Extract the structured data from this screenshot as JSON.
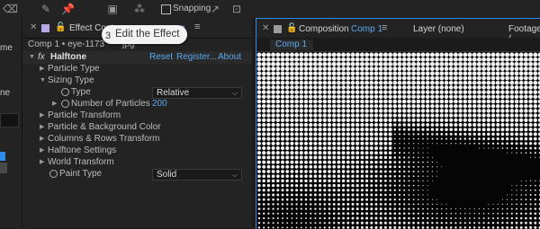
{
  "toolbar": {
    "icons": [
      "eraser-icon",
      "brush-icon",
      "pin-icon",
      "camera-icon",
      "scatter-icon",
      "snapping-icon"
    ],
    "snapping_label": "Snapping"
  },
  "left_panel": {
    "label_top": "me",
    "label_mid": "ne"
  },
  "effect_controls": {
    "tab_title": "Effect Contr",
    "tab_title_suffix": "g",
    "header": "Comp 1 • eye-1173",
    "header_suffix": "jpg",
    "effect_name": "Halftone",
    "fx_badge": "fx",
    "links": {
      "reset": "Reset",
      "register": "Register...",
      "about": "About"
    },
    "rows": [
      {
        "label": "Particle Type",
        "expanded": false
      },
      {
        "label": "Sizing Type",
        "expanded": true
      },
      {
        "label": "Type",
        "value": "Relative"
      },
      {
        "label": "Number of Particles",
        "value": "200"
      },
      {
        "label": "Particle Transform",
        "expanded": false
      },
      {
        "label": "Particle & Background Color",
        "expanded": false
      },
      {
        "label": "Columns & Rows Transform",
        "expanded": false
      },
      {
        "label": "Halftone Settings",
        "expanded": false
      },
      {
        "label": "World Transform",
        "expanded": false
      },
      {
        "label": "Paint Type",
        "value": "Solid"
      }
    ]
  },
  "callout": {
    "number": "3",
    "text": "Edit the Effect"
  },
  "composition": {
    "tab_label": "Composition",
    "tab_comp_name": "Comp 1",
    "layer_label": "Layer (none)",
    "footage_label": "Footage (",
    "subtab": "Comp 1"
  },
  "colors": {
    "accent": "#2d8ceb",
    "panel": "#232323",
    "link": "#5aa9f0",
    "swatch": "#b9a6e6"
  }
}
